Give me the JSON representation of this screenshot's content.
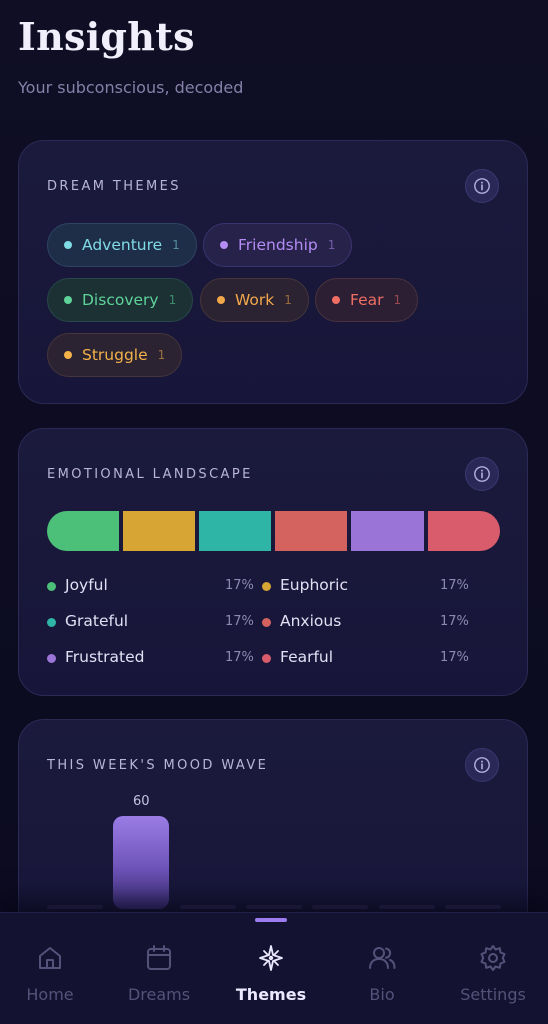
{
  "header": {
    "title": "Insights",
    "subtitle": "Your subconscious, decoded"
  },
  "dream_themes": {
    "title": "DREAM THEMES",
    "info_icon": "info-icon",
    "chips": [
      {
        "label": "Adventure",
        "count": "1",
        "color": "#7fdbe6"
      },
      {
        "label": "Friendship",
        "count": "1",
        "color": "#b58cf6"
      },
      {
        "label": "Discovery",
        "count": "1",
        "color": "#5fd39a"
      },
      {
        "label": "Work",
        "count": "1",
        "color": "#f2a84a"
      },
      {
        "label": "Fear",
        "count": "1",
        "color": "#ef6e63"
      },
      {
        "label": "Struggle",
        "count": "1",
        "color": "#f4b248"
      }
    ]
  },
  "emotional_landscape": {
    "title": "EMOTIONAL LANDSCAPE",
    "info_icon": "info-icon",
    "emotions": [
      {
        "label": "Joyful",
        "percent": "17%",
        "color": "#4cbf78"
      },
      {
        "label": "Euphoric",
        "percent": "17%",
        "color": "#d6a533"
      },
      {
        "label": "Grateful",
        "percent": "17%",
        "color": "#2fb5a5"
      },
      {
        "label": "Anxious",
        "percent": "17%",
        "color": "#d4625f"
      },
      {
        "label": "Frustrated",
        "percent": "17%",
        "color": "#9b74d8"
      },
      {
        "label": "Fearful",
        "percent": "17%",
        "color": "#d85c6c"
      }
    ]
  },
  "mood_wave": {
    "title": "THIS WEEK'S MOOD WAVE",
    "info_icon": "info-icon",
    "max": 100,
    "values": [
      0,
      60,
      0,
      0,
      0,
      0,
      0
    ],
    "labels": [
      "",
      "60",
      "",
      "",
      "",
      "",
      ""
    ]
  },
  "nav": {
    "items": [
      {
        "label": "Home",
        "icon": "home-icon"
      },
      {
        "label": "Dreams",
        "icon": "calendar-icon"
      },
      {
        "label": "Themes",
        "icon": "sparkle-icon"
      },
      {
        "label": "Bio",
        "icon": "users-icon"
      },
      {
        "label": "Settings",
        "icon": "gear-icon"
      }
    ],
    "active": "Themes"
  },
  "colors": {
    "accent": "#9d7cf0",
    "background": "#0d0c22",
    "card": "#1b1a3c"
  }
}
